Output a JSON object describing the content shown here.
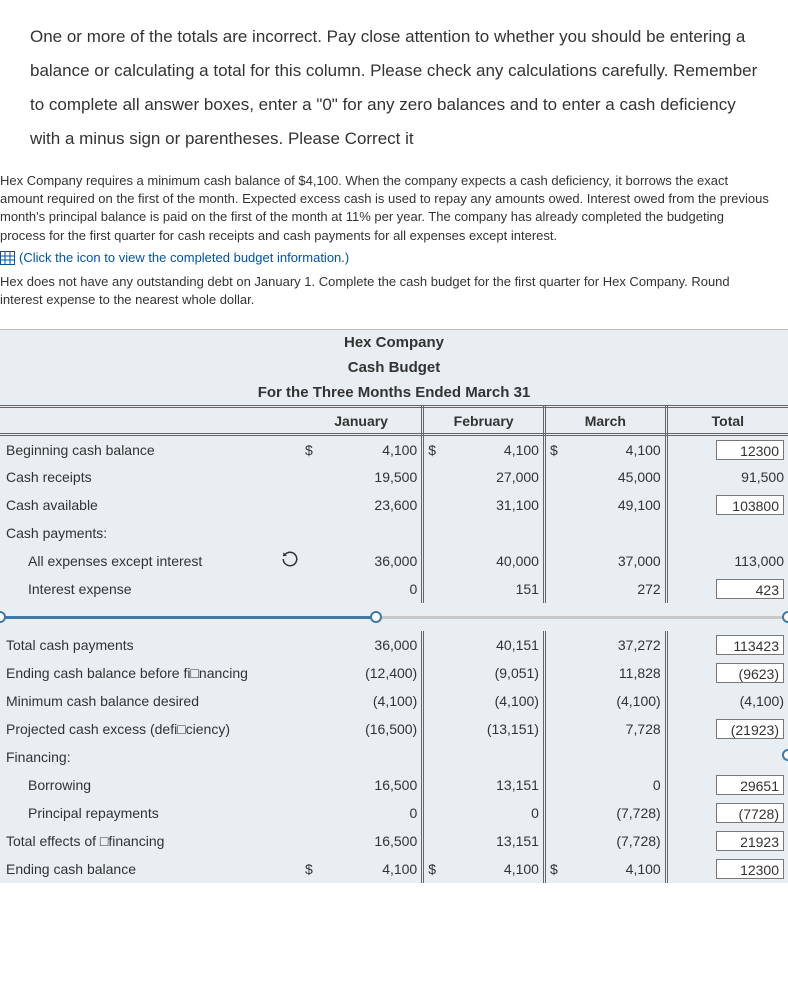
{
  "question": "One or more of the totals are incorrect. Pay close attention to whether you should be entering a balance or calculating a total for this column. Please check any calculations carefully. Remember to complete all answer boxes, enter a \"0\" for any zero balances and to enter a cash deficiency with a minus sign or parentheses. Please Correct it",
  "problem": {
    "p1": "Hex Company requires a minimum cash balance of $4,100. When the company expects a cash deficiency, it borrows the exact amount required on the first of the month. Expected excess cash is used to repay any amounts owed. Interest owed from the previous month's principal balance is paid on the first of the month at 11% per year. The company has already completed the budgeting process for the first quarter for cash receipts and cash payments for all expenses except interest.",
    "link": "(Click the icon to view the completed budget information.)",
    "p2": "Hex does not have any outstanding debt on January 1. Complete the cash budget for the first quarter for Hex Company. Round interest expense to the nearest whole dollar."
  },
  "header": {
    "l1": "Hex Company",
    "l2": "Cash Budget",
    "l3": "For the Three Months Ended March 31"
  },
  "cols": {
    "c1": "January",
    "c2": "February",
    "c3": "March",
    "c4": "Total"
  },
  "rows": {
    "beg": {
      "label": "Beginning cash balance",
      "jan": "4,100",
      "jan_d": "$",
      "feb": "4,100",
      "feb_d": "$",
      "mar": "4,100",
      "mar_d": "$",
      "tot": "12300",
      "tot_box": true
    },
    "rec": {
      "label": "Cash receipts",
      "jan": "19,500",
      "feb": "27,000",
      "mar": "45,000",
      "tot": "91,500"
    },
    "avail": {
      "label": "Cash available",
      "jan": "23,600",
      "feb": "31,100",
      "mar": "49,100",
      "tot": "103800",
      "tot_box": true
    },
    "pay": {
      "label": "Cash payments:"
    },
    "exp": {
      "label": "All expenses except interest",
      "jan": "36,000",
      "feb": "40,000",
      "mar": "37,000",
      "tot": "113,000",
      "icon": true
    },
    "int": {
      "label": "Interest expense",
      "jan": "0",
      "feb": "151",
      "mar": "272",
      "tot": "423",
      "tot_box": true
    },
    "tpay": {
      "label": "Total cash payments",
      "jan": "36,000",
      "feb": "40,151",
      "mar": "37,272",
      "tot": "113423",
      "tot_box": true
    },
    "ebf": {
      "label": "Ending cash balance before fi□nancing",
      "jan": "(12,400)",
      "feb": "(9,051)",
      "mar": "11,828",
      "tot": "(9623)",
      "tot_box": true
    },
    "min": {
      "label": "Minimum cash balance desired",
      "jan": "(4,100)",
      "feb": "(4,100)",
      "mar": "(4,100)",
      "tot": "(4,100)"
    },
    "proj": {
      "label": "Projected cash excess (defi□ciency)",
      "jan": "(16,500)",
      "feb": "(13,151)",
      "mar": "7,728",
      "tot": "(21923)",
      "tot_box": true
    },
    "fin": {
      "label": "Financing:"
    },
    "bor": {
      "label": "Borrowing",
      "jan": "16,500",
      "feb": "13,151",
      "mar": "0",
      "tot": "29651",
      "tot_box": true
    },
    "prin": {
      "label": "Principal repayments",
      "jan": "0",
      "feb": "0",
      "mar": "(7,728)",
      "tot": "(7728)",
      "tot_box": true
    },
    "tfin": {
      "label": "Total effects of □financing",
      "jan": "16,500",
      "feb": "13,151",
      "mar": "(7,728)",
      "tot": "21923",
      "tot_box": true
    },
    "end": {
      "label": "Ending cash balance",
      "jan": "4,100",
      "jan_d": "$",
      "feb": "4,100",
      "feb_d": "$",
      "mar": "4,100",
      "mar_d": "$",
      "tot": "12300",
      "tot_box": true
    }
  }
}
